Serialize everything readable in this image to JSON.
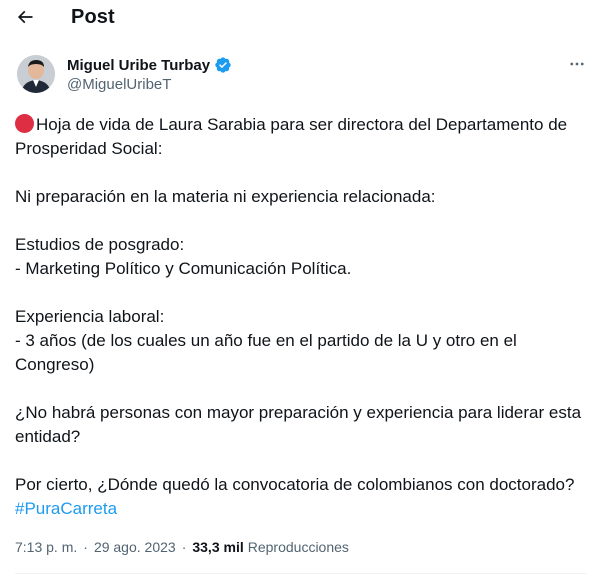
{
  "header": {
    "title": "Post"
  },
  "author": {
    "name": "Miguel Uribe Turbay",
    "handle": "@MiguelUribeT",
    "verified": true
  },
  "post": {
    "line1": "Hoja de vida de Laura Sarabia para ser directora del Departamento de Prosperidad Social:",
    "line2": "Ni preparación en la materia ni experiencia relacionada:",
    "line3": "Estudios de posgrado:",
    "line4": "- Marketing Político y Comunicación Política.",
    "line5": "Experiencia laboral:",
    "line6": "- 3 años (de los cuales un año fue en el partido de la U y otro en el Congreso)",
    "line7": "¿No habrá personas con mayor preparación y experiencia para liderar esta entidad?",
    "line8_prefix": "Por cierto, ¿Dónde quedó la convocatoria de colombianos con doctorado? ",
    "hashtag": "#PuraCarreta"
  },
  "meta": {
    "time": "7:13 p. m.",
    "separator": "·",
    "date": "29 ago. 2023",
    "views_count": "33,3 mil",
    "views_label": "Reproducciones"
  },
  "colors": {
    "accent": "#1d9bf0",
    "text": "#0f1419",
    "secondary": "#536471",
    "red_circle": "#dd2e44"
  },
  "icons": {
    "back": "arrow-left-icon",
    "verified": "verified-badge-icon",
    "more": "more-horizontal-icon",
    "circle": "red-circle-emoji"
  }
}
